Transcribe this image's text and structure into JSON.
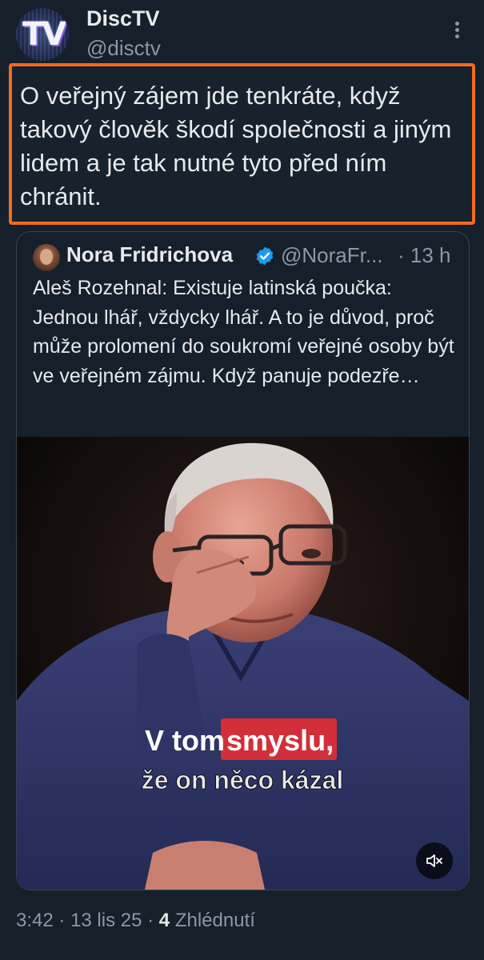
{
  "post": {
    "author_name": "DiscTV",
    "author_handle": "@disctv",
    "avatar_text": "TV",
    "text": "O veřejný zájem jde tenkráte, když takový člověk škodí společnosti a jiným lidem a je tak nutné tyto před ním chránit.",
    "highlight_color": "#f26b1d"
  },
  "quote": {
    "author_name": "Nora Fridrichova",
    "author_handle": "@NoraFr...",
    "separator": "·",
    "time": "13 h",
    "text": "Aleš Rozehnal: Existuje latinská poučka: Jednou lhář, vždycky lhář. A to je důvod, proč může prolomení do soukromí veřejné osoby být ve veřejném zájmu. Když panuje podezře…",
    "video": {
      "caption_line1_a": "V tom",
      "caption_line1_b": "smyslu,",
      "caption_line2": "že on něco kázal"
    }
  },
  "footer": {
    "time": "3:42",
    "sep1": "·",
    "date": "13 lis 25",
    "sep2": "·",
    "views_count": "4",
    "views_label": "Zhlédnutí"
  },
  "icons": {
    "more": "more-vertical-icon",
    "verified": "verified-badge-icon",
    "mute": "mute-icon"
  },
  "colors": {
    "background": "#15202b",
    "text": "#e7e9ea",
    "secondary": "#8b98a5",
    "verified": "#1d9bf0",
    "caption_highlight": "#d32f3a"
  }
}
